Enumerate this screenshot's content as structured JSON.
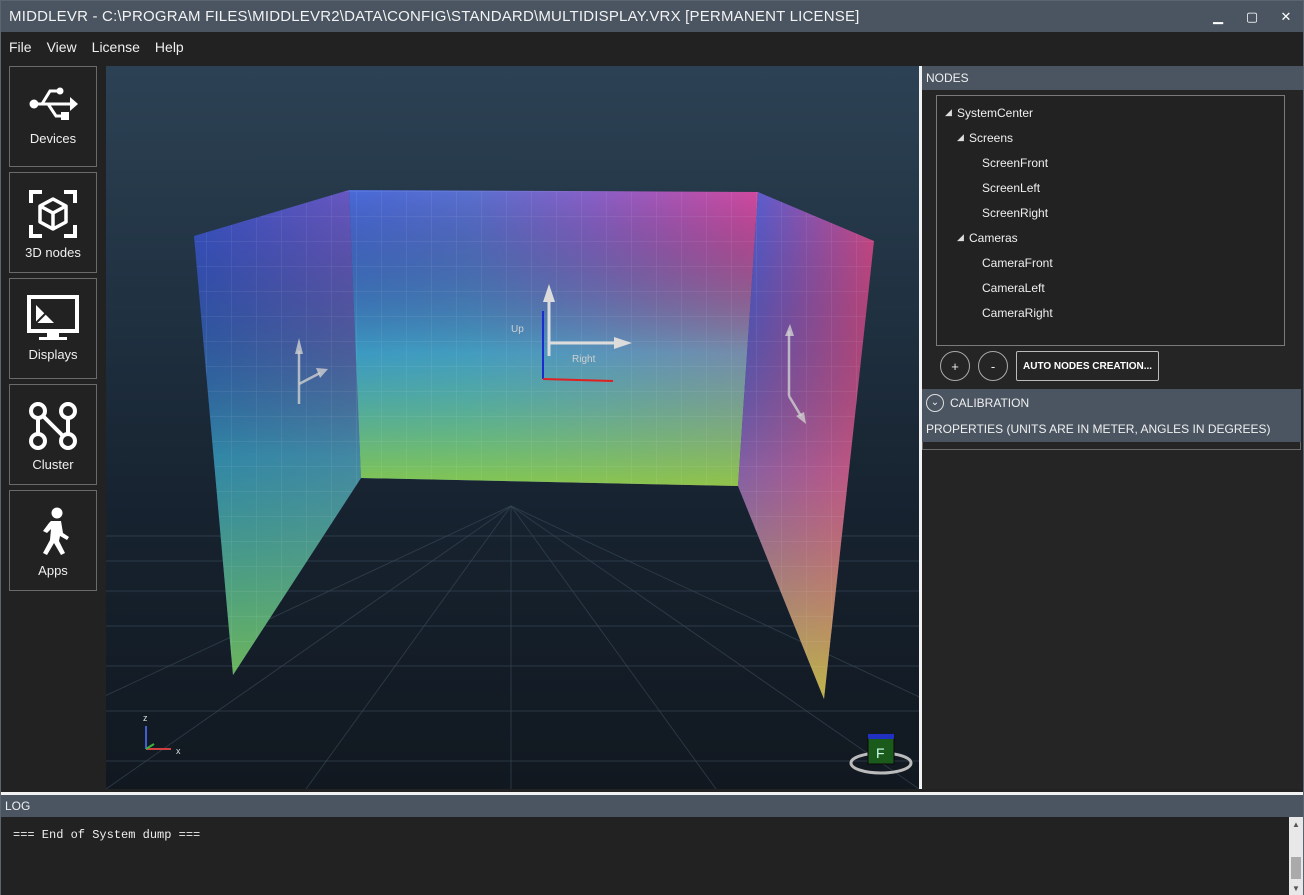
{
  "window": {
    "title": "MIDDLEVR - C:\\PROGRAM FILES\\MIDDLEVR2\\DATA\\CONFIG\\STANDARD\\MULTIDISPLAY.VRX [PERMANENT LICENSE]",
    "minimize_glyph": "▁",
    "maximize_glyph": "▢",
    "close_glyph": "✕"
  },
  "menu": [
    "File",
    "View",
    "License",
    "Help"
  ],
  "sidebar": {
    "items": [
      {
        "label": "Devices",
        "icon": "usb-icon"
      },
      {
        "label": "3D nodes",
        "icon": "cube-icon"
      },
      {
        "label": "Displays",
        "icon": "monitor-icon"
      },
      {
        "label": "Cluster",
        "icon": "cluster-icon"
      },
      {
        "label": "Apps",
        "icon": "walking-person-icon"
      }
    ]
  },
  "viewport": {
    "up_label": "Up",
    "right_label": "Right",
    "gizmo_z": "z",
    "gizmo_x": "x",
    "view_cube_face": "F"
  },
  "nodes_panel": {
    "header": "NODES",
    "tree": [
      {
        "label": "SystemCenter",
        "expanded": true,
        "depth": 0
      },
      {
        "label": "Screens",
        "expanded": true,
        "depth": 1
      },
      {
        "label": "ScreenFront",
        "depth": 2
      },
      {
        "label": "ScreenLeft",
        "depth": 2
      },
      {
        "label": "ScreenRight",
        "depth": 2
      },
      {
        "label": "Cameras",
        "expanded": true,
        "depth": 1
      },
      {
        "label": "CameraFront",
        "depth": 2
      },
      {
        "label": "CameraLeft",
        "depth": 2
      },
      {
        "label": "CameraRight",
        "depth": 2
      }
    ],
    "add_label": "+",
    "remove_label": "-",
    "auto_label": "AUTO NODES CREATION..."
  },
  "calibration": {
    "label": "CALIBRATION"
  },
  "properties": {
    "label": "PROPERTIES (UNITS ARE IN METER, ANGLES IN DEGREES)"
  },
  "log": {
    "header": "LOG",
    "text": "=== End of System dump ==="
  },
  "colors": {
    "titlebar": "#4a5561",
    "background": "#222222",
    "accent_white": "#f2f2f2"
  }
}
